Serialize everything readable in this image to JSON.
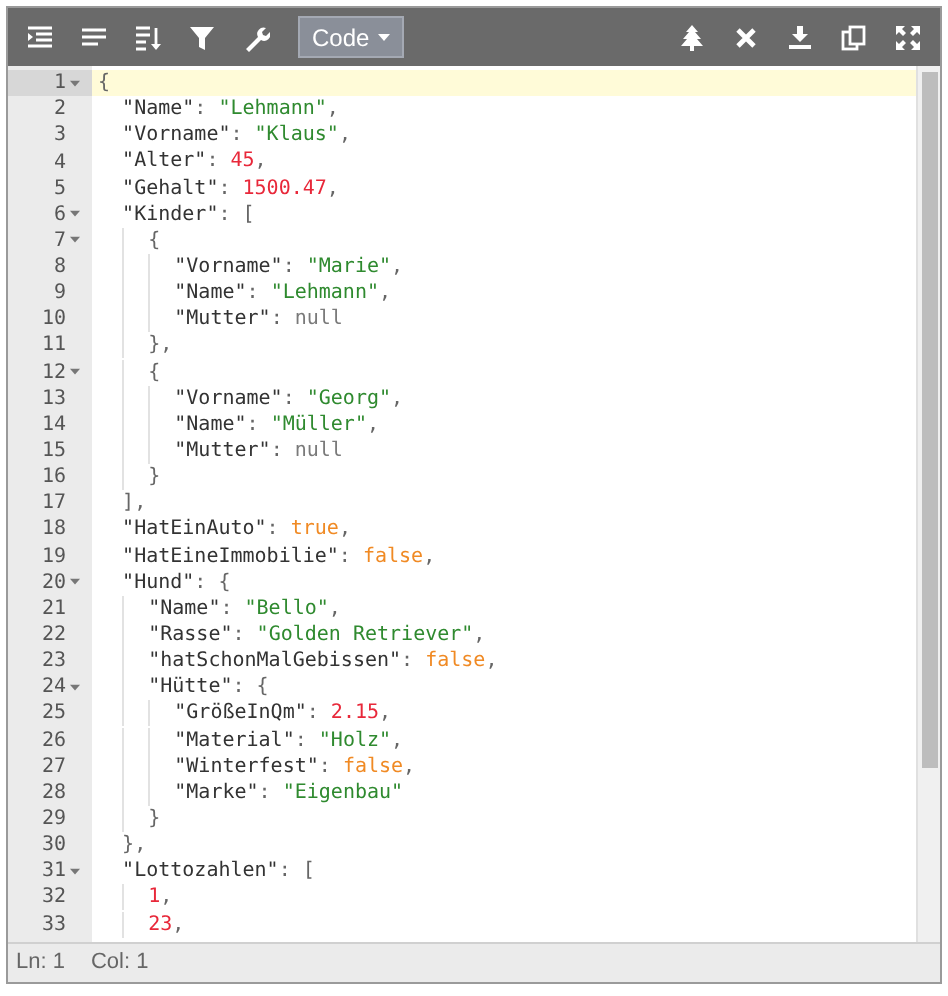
{
  "toolbar": {
    "left_buttons": [
      {
        "kind": "indent"
      },
      {
        "kind": "compact"
      },
      {
        "kind": "sort"
      },
      {
        "kind": "filter"
      },
      {
        "kind": "wrench"
      }
    ],
    "mode": {
      "label": "Code"
    },
    "right_buttons": [
      {
        "kind": "tree"
      },
      {
        "kind": "close"
      },
      {
        "kind": "download"
      },
      {
        "kind": "copy"
      },
      {
        "kind": "fullscreen"
      }
    ]
  },
  "lines": [
    {
      "number": "1",
      "foldable": true,
      "selected": true,
      "tokens": [
        {
          "kind": "punct",
          "text": "{"
        }
      ]
    },
    {
      "number": "2",
      "foldable": false,
      "selected": false,
      "tokens": [
        {
          "kind": "key",
          "text": "  \"Name\""
        },
        {
          "kind": "punct",
          "text": ": "
        },
        {
          "kind": "string",
          "text": "\"Lehmann\""
        },
        {
          "kind": "punct",
          "text": ","
        }
      ]
    },
    {
      "number": "3",
      "foldable": false,
      "selected": false,
      "tokens": [
        {
          "kind": "key",
          "text": "  \"Vorname\""
        },
        {
          "kind": "punct",
          "text": ": "
        },
        {
          "kind": "string",
          "text": "\"Klaus\""
        },
        {
          "kind": "punct",
          "text": ","
        }
      ]
    },
    {
      "number": "4",
      "foldable": false,
      "selected": false,
      "tokens": [
        {
          "kind": "key",
          "text": "  \"Alter\""
        },
        {
          "kind": "punct",
          "text": ": "
        },
        {
          "kind": "number",
          "text": "45"
        },
        {
          "kind": "punct",
          "text": ","
        }
      ]
    },
    {
      "number": "5",
      "foldable": false,
      "selected": false,
      "tokens": [
        {
          "kind": "key",
          "text": "  \"Gehalt\""
        },
        {
          "kind": "punct",
          "text": ": "
        },
        {
          "kind": "number",
          "text": "1500.47"
        },
        {
          "kind": "punct",
          "text": ","
        }
      ]
    },
    {
      "number": "6",
      "foldable": true,
      "selected": false,
      "tokens": [
        {
          "kind": "key",
          "text": "  \"Kinder\""
        },
        {
          "kind": "punct",
          "text": ": ["
        }
      ]
    },
    {
      "number": "7",
      "foldable": true,
      "selected": false,
      "tokens": [
        {
          "kind": "punct",
          "text": "    {"
        }
      ]
    },
    {
      "number": "8",
      "foldable": false,
      "selected": false,
      "tokens": [
        {
          "kind": "key",
          "text": "      \"Vorname\""
        },
        {
          "kind": "punct",
          "text": ": "
        },
        {
          "kind": "string",
          "text": "\"Marie\""
        },
        {
          "kind": "punct",
          "text": ","
        }
      ]
    },
    {
      "number": "9",
      "foldable": false,
      "selected": false,
      "tokens": [
        {
          "kind": "key",
          "text": "      \"Name\""
        },
        {
          "kind": "punct",
          "text": ": "
        },
        {
          "kind": "string",
          "text": "\"Lehmann\""
        },
        {
          "kind": "punct",
          "text": ","
        }
      ]
    },
    {
      "number": "10",
      "foldable": false,
      "selected": false,
      "tokens": [
        {
          "kind": "key",
          "text": "      \"Mutter\""
        },
        {
          "kind": "punct",
          "text": ": "
        },
        {
          "kind": "null",
          "text": "null"
        }
      ]
    },
    {
      "number": "11",
      "foldable": false,
      "selected": false,
      "tokens": [
        {
          "kind": "punct",
          "text": "    },"
        }
      ]
    },
    {
      "number": "12",
      "foldable": true,
      "selected": false,
      "tokens": [
        {
          "kind": "punct",
          "text": "    {"
        }
      ]
    },
    {
      "number": "13",
      "foldable": false,
      "selected": false,
      "tokens": [
        {
          "kind": "key",
          "text": "      \"Vorname\""
        },
        {
          "kind": "punct",
          "text": ": "
        },
        {
          "kind": "string",
          "text": "\"Georg\""
        },
        {
          "kind": "punct",
          "text": ","
        }
      ]
    },
    {
      "number": "14",
      "foldable": false,
      "selected": false,
      "tokens": [
        {
          "kind": "key",
          "text": "      \"Name\""
        },
        {
          "kind": "punct",
          "text": ": "
        },
        {
          "kind": "string",
          "text": "\"Müller\""
        },
        {
          "kind": "punct",
          "text": ","
        }
      ]
    },
    {
      "number": "15",
      "foldable": false,
      "selected": false,
      "tokens": [
        {
          "kind": "key",
          "text": "      \"Mutter\""
        },
        {
          "kind": "punct",
          "text": ": "
        },
        {
          "kind": "null",
          "text": "null"
        }
      ]
    },
    {
      "number": "16",
      "foldable": false,
      "selected": false,
      "tokens": [
        {
          "kind": "punct",
          "text": "    }"
        }
      ]
    },
    {
      "number": "17",
      "foldable": false,
      "selected": false,
      "tokens": [
        {
          "kind": "punct",
          "text": "  ],"
        }
      ]
    },
    {
      "number": "18",
      "foldable": false,
      "selected": false,
      "tokens": [
        {
          "kind": "key",
          "text": "  \"HatEinAuto\""
        },
        {
          "kind": "punct",
          "text": ": "
        },
        {
          "kind": "boolean",
          "text": "true"
        },
        {
          "kind": "punct",
          "text": ","
        }
      ]
    },
    {
      "number": "19",
      "foldable": false,
      "selected": false,
      "tokens": [
        {
          "kind": "key",
          "text": "  \"HatEineImmobilie\""
        },
        {
          "kind": "punct",
          "text": ": "
        },
        {
          "kind": "boolean",
          "text": "false"
        },
        {
          "kind": "punct",
          "text": ","
        }
      ]
    },
    {
      "number": "20",
      "foldable": true,
      "selected": false,
      "tokens": [
        {
          "kind": "key",
          "text": "  \"Hund\""
        },
        {
          "kind": "punct",
          "text": ": {"
        }
      ]
    },
    {
      "number": "21",
      "foldable": false,
      "selected": false,
      "tokens": [
        {
          "kind": "key",
          "text": "    \"Name\""
        },
        {
          "kind": "punct",
          "text": ": "
        },
        {
          "kind": "string",
          "text": "\"Bello\""
        },
        {
          "kind": "punct",
          "text": ","
        }
      ]
    },
    {
      "number": "22",
      "foldable": false,
      "selected": false,
      "tokens": [
        {
          "kind": "key",
          "text": "    \"Rasse\""
        },
        {
          "kind": "punct",
          "text": ": "
        },
        {
          "kind": "string",
          "text": "\"Golden Retriever\""
        },
        {
          "kind": "punct",
          "text": ","
        }
      ]
    },
    {
      "number": "23",
      "foldable": false,
      "selected": false,
      "tokens": [
        {
          "kind": "key",
          "text": "    \"hatSchonMalGebissen\""
        },
        {
          "kind": "punct",
          "text": ": "
        },
        {
          "kind": "boolean",
          "text": "false"
        },
        {
          "kind": "punct",
          "text": ","
        }
      ]
    },
    {
      "number": "24",
      "foldable": true,
      "selected": false,
      "tokens": [
        {
          "kind": "key",
          "text": "    \"Hütte\""
        },
        {
          "kind": "punct",
          "text": ": {"
        }
      ]
    },
    {
      "number": "25",
      "foldable": false,
      "selected": false,
      "tokens": [
        {
          "kind": "key",
          "text": "      \"GrößeInQm\""
        },
        {
          "kind": "punct",
          "text": ": "
        },
        {
          "kind": "number",
          "text": "2.15"
        },
        {
          "kind": "punct",
          "text": ","
        }
      ]
    },
    {
      "number": "26",
      "foldable": false,
      "selected": false,
      "tokens": [
        {
          "kind": "key",
          "text": "      \"Material\""
        },
        {
          "kind": "punct",
          "text": ": "
        },
        {
          "kind": "string",
          "text": "\"Holz\""
        },
        {
          "kind": "punct",
          "text": ","
        }
      ]
    },
    {
      "number": "27",
      "foldable": false,
      "selected": false,
      "tokens": [
        {
          "kind": "key",
          "text": "      \"Winterfest\""
        },
        {
          "kind": "punct",
          "text": ": "
        },
        {
          "kind": "boolean",
          "text": "false"
        },
        {
          "kind": "punct",
          "text": ","
        }
      ]
    },
    {
      "number": "28",
      "foldable": false,
      "selected": false,
      "tokens": [
        {
          "kind": "key",
          "text": "      \"Marke\""
        },
        {
          "kind": "punct",
          "text": ": "
        },
        {
          "kind": "string",
          "text": "\"Eigenbau\""
        }
      ]
    },
    {
      "number": "29",
      "foldable": false,
      "selected": false,
      "tokens": [
        {
          "kind": "punct",
          "text": "    }"
        }
      ]
    },
    {
      "number": "30",
      "foldable": false,
      "selected": false,
      "tokens": [
        {
          "kind": "punct",
          "text": "  },"
        }
      ]
    },
    {
      "number": "31",
      "foldable": true,
      "selected": false,
      "tokens": [
        {
          "kind": "key",
          "text": "  \"Lottozahlen\""
        },
        {
          "kind": "punct",
          "text": ": ["
        }
      ]
    },
    {
      "number": "32",
      "foldable": false,
      "selected": false,
      "tokens": [
        {
          "kind": "number",
          "text": "    1"
        },
        {
          "kind": "punct",
          "text": ","
        }
      ]
    },
    {
      "number": "33",
      "foldable": false,
      "selected": false,
      "tokens": [
        {
          "kind": "number",
          "text": "    23"
        },
        {
          "kind": "punct",
          "text": ","
        }
      ]
    }
  ],
  "status_bar": {
    "line": "Ln: 1",
    "column": "Col: 1"
  }
}
